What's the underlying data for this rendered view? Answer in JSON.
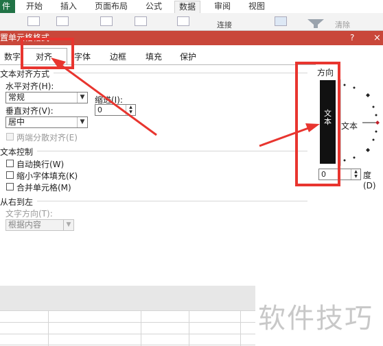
{
  "ribbon": {
    "file_tab": "件",
    "tabs": [
      "开始",
      "插入",
      "页面布局",
      "公式",
      "数据",
      "审阅",
      "视图"
    ],
    "active_tab": "数据",
    "connect_label": "连接",
    "clear_label": "清除"
  },
  "dialog": {
    "title": "置单元格格式",
    "help": "?",
    "close": "×",
    "tabs": [
      "数字",
      "对齐",
      "字体",
      "边框",
      "填充",
      "保护"
    ],
    "active_tab": "对齐"
  },
  "alignment": {
    "section_title": "文本对齐方式",
    "horizontal_label": "水平对齐(H):",
    "horizontal_value": "常规",
    "indent_label": "缩进(I):",
    "indent_value": "0",
    "vertical_label": "垂直对齐(V):",
    "vertical_value": "居中",
    "distributed_label": "两端分散对齐(E)"
  },
  "text_control": {
    "section_title": "文本控制",
    "wrap_label": "自动换行(W)",
    "shrink_label": "缩小字体填充(K)",
    "merge_label": "合并单元格(M)"
  },
  "rtl": {
    "section_title": "从右到左",
    "direction_label": "文字方向(T):",
    "direction_value": "根据内容"
  },
  "orientation": {
    "section_title": "方向",
    "vertical_text": "文本",
    "dial_text": "文本",
    "degrees_value": "0",
    "degrees_label": "度(D)"
  },
  "watermark": "软件技巧",
  "colors": {
    "highlight": "#e8352f",
    "title_bar": "#c9473a",
    "file_tab": "#217346"
  }
}
